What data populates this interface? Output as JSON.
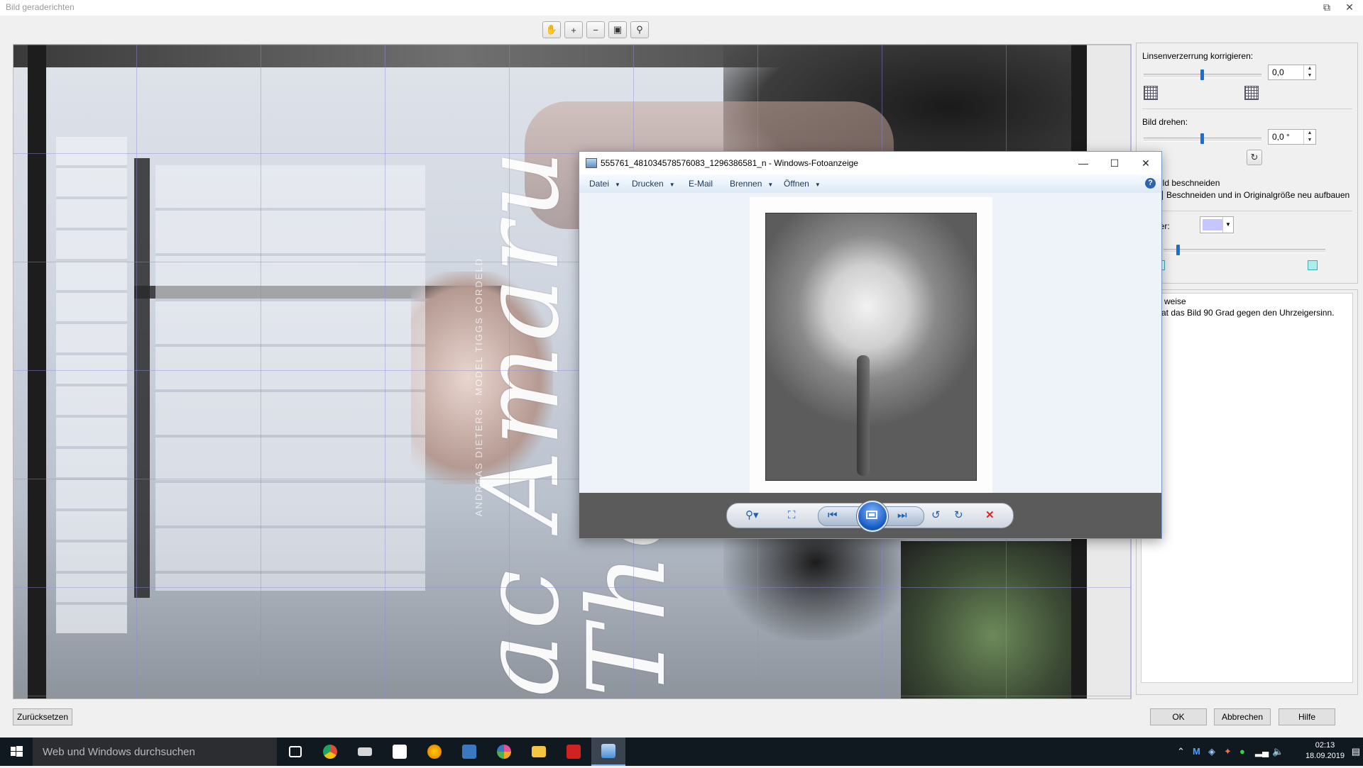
{
  "editor": {
    "title": "Bild geraderichten",
    "window_buttons": [
      "⧉",
      "✕"
    ],
    "toolbar": [
      {
        "name": "hand-tool",
        "glyph": "✋"
      },
      {
        "name": "zoom-in",
        "glyph": "+"
      },
      {
        "name": "zoom-out",
        "glyph": "−"
      },
      {
        "name": "fit-to-window",
        "glyph": "▣"
      },
      {
        "name": "actual-size",
        "glyph": "⚲"
      }
    ],
    "canvas_text": {
      "script": "ac Amaru The",
      "watermark": "ANDREAS DIETERS · MODEL TIGGS CORDELD"
    },
    "reset_label": "Zurücksetzen",
    "ok_label": "OK",
    "cancel_label": "Abbrechen",
    "help_label": "Hilfe"
  },
  "panel": {
    "lens_label": "Linsenverzerrung korrigieren:",
    "lens_value": "0,0",
    "lens_position": 0.5,
    "rotate_label": "Bild drehen:",
    "rotate_value": "0,0 °",
    "rotate_position": 0.5,
    "crop_label": "ild beschneiden",
    "crop_rebuild_label": "Beschneiden und in Originalgröße neu aufbauen",
    "grid_label": "tter:",
    "grid_color": "#c6c6ff",
    "grid_position": 0.1,
    "hint_title": "weise",
    "hint_text": "at das Bild 90 Grad gegen den Uhrzeigersinn."
  },
  "viewer": {
    "title": "555761_481034578576083_1296386581_n - Windows-Fotoanzeige",
    "window_buttons": [
      "—",
      "☐",
      "✕"
    ],
    "menu": [
      {
        "label": "Datei",
        "dropdown": true
      },
      {
        "label": "Drucken",
        "dropdown": true
      },
      {
        "label": "E-Mail",
        "dropdown": false
      },
      {
        "label": "Brennen",
        "dropdown": true
      },
      {
        "label": "Öffnen",
        "dropdown": true
      }
    ],
    "help_glyph": "?",
    "controls": [
      {
        "name": "zoom-dropdown",
        "glyph": "⚲▾"
      },
      {
        "name": "actual-size",
        "glyph": "⛶"
      },
      {
        "name": "previous",
        "glyph": "⏮"
      },
      {
        "name": "next",
        "glyph": "⏭"
      },
      {
        "name": "rotate-left",
        "glyph": "↺"
      },
      {
        "name": "rotate-right",
        "glyph": "↻"
      },
      {
        "name": "delete",
        "glyph": "✕"
      }
    ]
  },
  "taskbar": {
    "search_placeholder": "Web und Windows durchsuchen",
    "apps": [
      {
        "name": "task-view",
        "color": "#ffffff"
      },
      {
        "name": "chrome",
        "color": "#dd4b39"
      },
      {
        "name": "explorer-folder",
        "color": "#d6d6d6"
      },
      {
        "name": "store",
        "color": "#ffffff"
      },
      {
        "name": "app-flame",
        "color": "#f0a000"
      },
      {
        "name": "photos",
        "color": "#3a79c2"
      },
      {
        "name": "picasa",
        "color": "#e94f9b"
      },
      {
        "name": "file-explorer",
        "color": "#f5c542"
      },
      {
        "name": "red-app",
        "color": "#d12222"
      },
      {
        "name": "photo-viewer",
        "color": "#4c8fd6"
      }
    ],
    "time": "02:13",
    "date": "18.09.2019"
  }
}
